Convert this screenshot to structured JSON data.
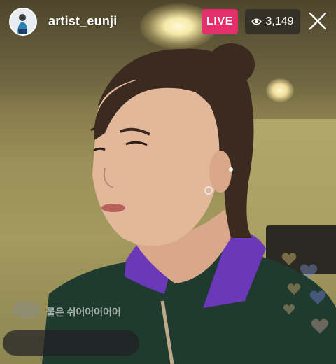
{
  "stream": {
    "username": "artist_eunji",
    "live_label": "LIVE",
    "viewer_count": "3,149",
    "icons": {
      "viewers": "eye-icon",
      "close": "close-icon",
      "reactions": "heart-icon"
    }
  },
  "comments": [
    {
      "text": "물은 쉬어어어어어"
    }
  ],
  "comment_box": {
    "placeholder": ""
  },
  "colors": {
    "live_badge": "#e1306c",
    "viewer_badge": "#302c24",
    "text": "#ffffff"
  }
}
